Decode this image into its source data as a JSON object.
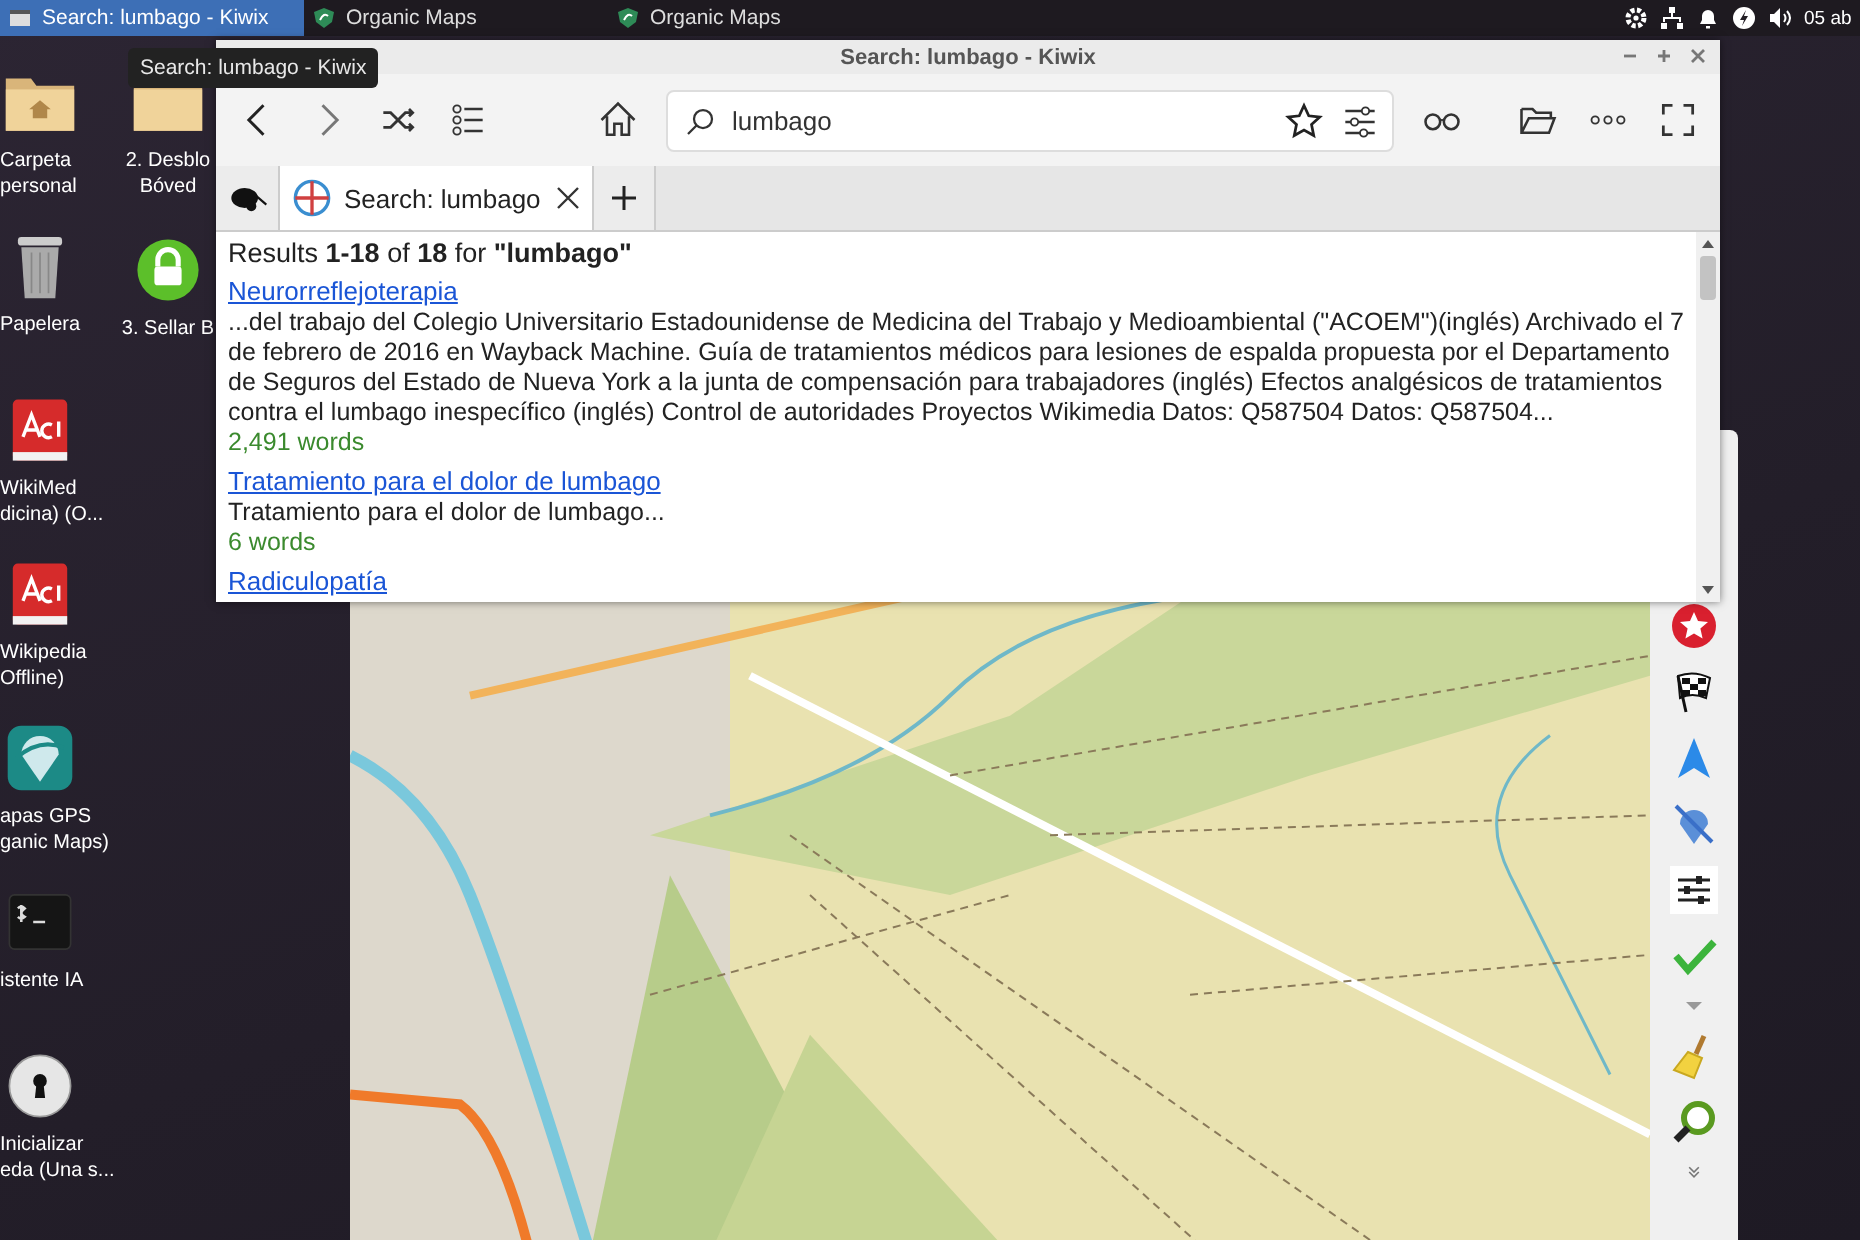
{
  "taskbar": {
    "tasks": [
      {
        "label": "Search: lumbago - Kiwix",
        "selected": true,
        "kind": "kiwix"
      },
      {
        "label": "Organic Maps",
        "selected": false,
        "kind": "maps"
      },
      {
        "label": "Organic Maps",
        "selected": false,
        "kind": "maps"
      }
    ],
    "clock": "05 ab"
  },
  "desktop_icons_column_1": [
    {
      "kind": "folder",
      "lines": [
        "Carpeta",
        "personal"
      ]
    },
    {
      "kind": "trash",
      "lines": [
        "Papelera"
      ]
    },
    {
      "kind": "book",
      "lines": [
        "WikiMed",
        "dicina) (O..."
      ]
    },
    {
      "kind": "book",
      "lines": [
        "Wikipedia",
        "Offline)"
      ]
    },
    {
      "kind": "maps",
      "lines": [
        "apas GPS",
        "ganic Maps)"
      ]
    },
    {
      "kind": "terminal",
      "lines": [
        "istente IA"
      ]
    },
    {
      "kind": "keyhole",
      "lines": [
        "Inicializar",
        "eda (Una s..."
      ]
    }
  ],
  "desktop_icons_column_2": [
    {
      "kind": "folder",
      "lines": [
        "2. Desblo",
        "Bóved"
      ]
    },
    {
      "kind": "lock",
      "lines": [
        "3. Sellar B"
      ]
    }
  ],
  "tooltip": "Search: lumbago - Kiwix",
  "kiwix": {
    "title": "Search: lumbago - Kiwix",
    "search": {
      "value": "lumbago"
    },
    "tabs": [
      {
        "label": "Search: lumbago",
        "selected": true
      }
    ],
    "results_summary": "Results **1-18** of **18** for **\"lumbago\"**",
    "results": [
      {
        "title": "Neurorreflejoterapia",
        "snippet": "...del trabajo del Colegio Universitario Estadounidense de Medicina del Trabajo y Medioambiental (\"ACOEM\")(inglés) Archivado el 7 de febrero de 2016 en Wayback Machine. Guía de tratamientos médicos para lesiones de espalda propuesta por el Departamento de Seguros del Estado de Nueva York a la junta de compensación para trabajadores (inglés) Efectos analgésicos de tratamientos contra el lumbago inespecífico (inglés) Control de autoridades Proyectos Wikimedia Datos: Q587504 Datos: Q587504...",
        "words": "2,491 words"
      },
      {
        "title": "Tratamiento para el dolor de lumbago",
        "snippet": "Tratamiento para el dolor de lumbago...",
        "words": "6 words"
      },
      {
        "title": "Radiculopatía"
      }
    ]
  }
}
